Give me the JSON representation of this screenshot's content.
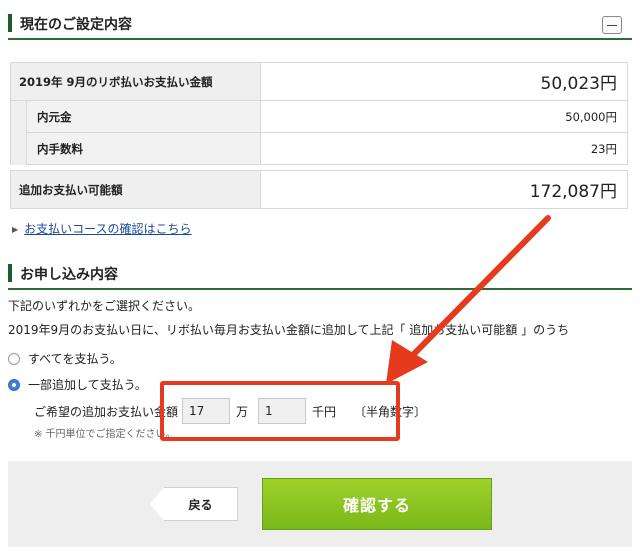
{
  "current": {
    "title": "現在のご設定内容",
    "rows": [
      {
        "label": "2019年 9月のリボ払いお支払い金額",
        "value": "50,023円"
      },
      {
        "label": "内元金",
        "value": "50,000円"
      },
      {
        "label": "内手数料",
        "value": "23円"
      }
    ],
    "available": {
      "label": "追加お支払い可能額",
      "value": "172,087円"
    },
    "course_link": "お支払いコースの確認はこちら"
  },
  "apply": {
    "title": "お申し込み内容",
    "intro1": "下記のいずれかをご選択ください。",
    "intro2": "2019年9月のお支払い日に、リボ払い毎月お支払い金額に追加して上記「 追加お支払い可能額 」のうち",
    "option_all": "すべてを支払う。",
    "option_partial": "一部追加して支払う。",
    "amount_label": "ご希望の追加お支払い金額",
    "amount_man": "17",
    "unit_man": "万",
    "amount_sen": "1",
    "unit_sen": "千円",
    "hint": "〔半角数字〕",
    "note": "※ 千円単位でご指定ください。",
    "selected_option": "partial"
  },
  "buttons": {
    "back": "戻る",
    "confirm": "確認する"
  },
  "colors": {
    "accent_green": "#2e6b3a",
    "confirm_green": "#8cc521",
    "highlight_red": "#e53a1e",
    "link_blue": "#1a4a9c"
  }
}
